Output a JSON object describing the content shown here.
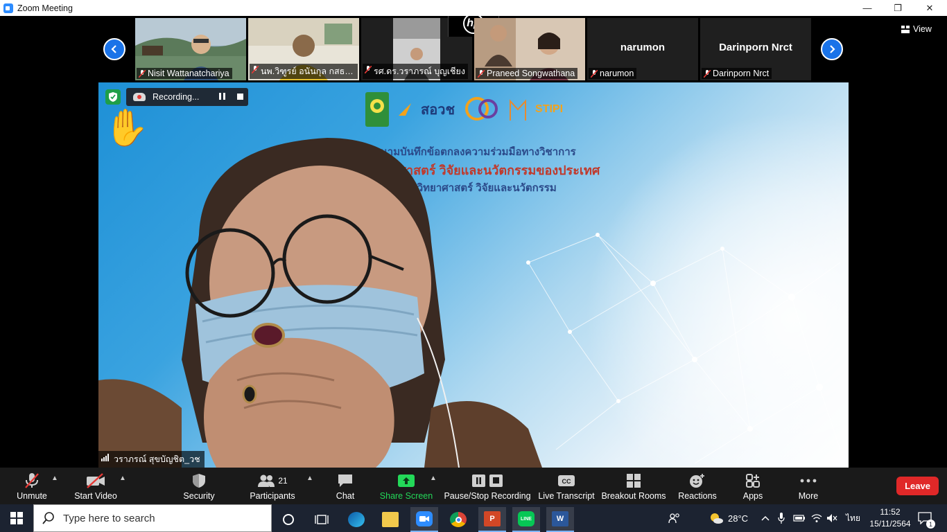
{
  "window": {
    "title": "Zoom Meeting",
    "minimize": "—",
    "maximize": "❐",
    "close": "✕"
  },
  "thumbnails": [
    {
      "name": "Nisit Wattanatchariya",
      "has_video": true
    },
    {
      "name": "นพ.วิฑูรย์ อนันกุล กสธฉ....",
      "has_video": true
    },
    {
      "name": "รศ.ดร.วราภรณ์ บุญเชียง",
      "has_video": true
    },
    {
      "name": "Praneed Songwathana",
      "has_video": true
    },
    {
      "name": "narumon",
      "has_video": false
    },
    {
      "name": "Darinporn Nrct",
      "has_video": false
    }
  ],
  "view_label": "View",
  "hp_logo": "hp",
  "main_video": {
    "speaker_name": "วราภรณ์ สุขบัญชิต_วช",
    "recording_label": "Recording...",
    "slide_line1": "ลงนามบันทึกข้อตกลงความร่วมมือทางวิชาการ",
    "slide_line2": "วิทยาศาสตร์ วิจัยและนวัตกรรมของประเทศ",
    "slide_line3": "อุดมศึกษา วิทยาศาสตร์ วิจัยและนวัตกรรม",
    "logo_text_1": "สอวช",
    "logo_text_2": "STIPI"
  },
  "toolbar": {
    "unmute": "Unmute",
    "start_video": "Start Video",
    "security": "Security",
    "participants": "Participants",
    "participants_count": "21",
    "chat": "Chat",
    "share_screen": "Share Screen",
    "pause_stop_recording": "Pause/Stop Recording",
    "live_transcript": "Live Transcript",
    "breakout_rooms": "Breakout Rooms",
    "reactions": "Reactions",
    "apps": "Apps",
    "more": "More",
    "leave": "Leave",
    "cc_badge": "CC"
  },
  "taskbar": {
    "search_placeholder": "Type here to search",
    "temperature": "28°C",
    "language": "ไทย",
    "time": "11:52",
    "date": "15/11/2564",
    "notifications_count": "1"
  },
  "colors": {
    "zoom_blue": "#1a73e8",
    "leave_red": "#e02828",
    "share_green": "#23d959",
    "toolbar_bg": "#1a1a1a",
    "taskbar_bg": "#1c2331"
  }
}
